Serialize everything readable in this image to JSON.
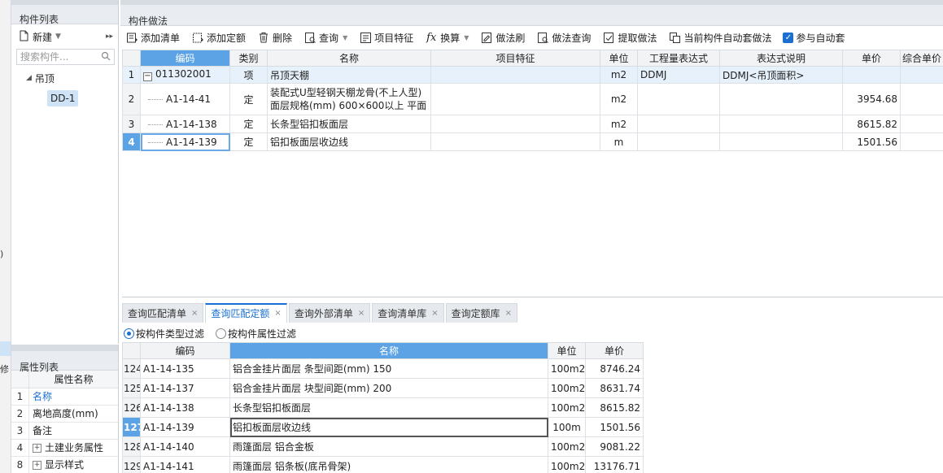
{
  "left_strip": {
    "frag1": "修",
    "frag2": ")"
  },
  "component_list": {
    "title": "构件列表",
    "new_label": "新建",
    "search_placeholder": "搜索构件...",
    "tree": {
      "parent": "吊顶",
      "child": "DD-1"
    }
  },
  "property_list": {
    "title": "属性列表",
    "header": "属性名称",
    "rows": [
      {
        "num": "1",
        "name": "名称"
      },
      {
        "num": "2",
        "name": "离地高度(mm)"
      },
      {
        "num": "3",
        "name": "备注"
      },
      {
        "num": "4",
        "name": "土建业务属性"
      },
      {
        "num": "8",
        "name": "显示样式"
      }
    ]
  },
  "main": {
    "title": "构件做法",
    "toolbar": {
      "add_list": "添加清单",
      "add_quota": "添加定额",
      "delete": "删除",
      "query": "查询",
      "item_feature": "项目特征",
      "convert": "换算",
      "method_brush": "做法刷",
      "method_query": "做法查询",
      "extract_method": "提取做法",
      "auto_method": "当前构件自动套做法",
      "auto_join": "参与自动套"
    },
    "top_headers": [
      "编码",
      "类别",
      "名称",
      "项目特征",
      "单位",
      "工程量表达式",
      "表达式说明",
      "单价",
      "综合单价"
    ],
    "top_rows": [
      {
        "num": "1",
        "code": "011302001",
        "type": "项",
        "name": "吊顶天棚",
        "feature": "",
        "unit": "m2",
        "expr": "DDMJ",
        "expr_desc": "DDMJ<吊顶面积>",
        "price": ""
      },
      {
        "num": "2",
        "code": "A1-14-41",
        "type": "定",
        "name": "装配式U型轻钢天棚龙骨(不上人型) 面层规格(mm) 600×600以上 平面",
        "feature": "",
        "unit": "m2",
        "expr": "",
        "expr_desc": "",
        "price": "3954.68"
      },
      {
        "num": "3",
        "code": "A1-14-138",
        "type": "定",
        "name": "长条型铝扣板面层",
        "feature": "",
        "unit": "m2",
        "expr": "",
        "expr_desc": "",
        "price": "8615.82"
      },
      {
        "num": "4",
        "code": "A1-14-139",
        "type": "定",
        "name": "铝扣板面层收边线",
        "feature": "",
        "unit": "m",
        "expr": "",
        "expr_desc": "",
        "price": "1501.56"
      }
    ],
    "tabs": [
      "查询匹配清单",
      "查询匹配定额",
      "查询外部清单",
      "查询清单库",
      "查询定额库"
    ],
    "filter": {
      "by_type": "按构件类型过滤",
      "by_attr": "按构件属性过滤"
    },
    "bottom_headers": [
      "编码",
      "名称",
      "单位",
      "单价"
    ],
    "bottom_rows": [
      {
        "num": "124",
        "code": "A1-14-135",
        "name": "铝合金挂片面层 条型间距(mm) 150",
        "unit": "100m2",
        "price": "8746.24"
      },
      {
        "num": "125",
        "code": "A1-14-137",
        "name": "铝合金挂片面层 块型间距(mm) 200",
        "unit": "100m2",
        "price": "8631.74"
      },
      {
        "num": "126",
        "code": "A1-14-138",
        "name": "长条型铝扣板面层",
        "unit": "100m2",
        "price": "8615.82"
      },
      {
        "num": "127",
        "code": "A1-14-139",
        "name": "铝扣板面层收边线",
        "unit": "100m",
        "price": "1501.56"
      },
      {
        "num": "128",
        "code": "A1-14-140",
        "name": "雨篷面层 铝合金板",
        "unit": "100m2",
        "price": "9081.22"
      },
      {
        "num": "129",
        "code": "A1-14-141",
        "name": "雨篷面层 铝条板(底吊骨架)",
        "unit": "100m2",
        "price": "13176.71"
      }
    ]
  }
}
